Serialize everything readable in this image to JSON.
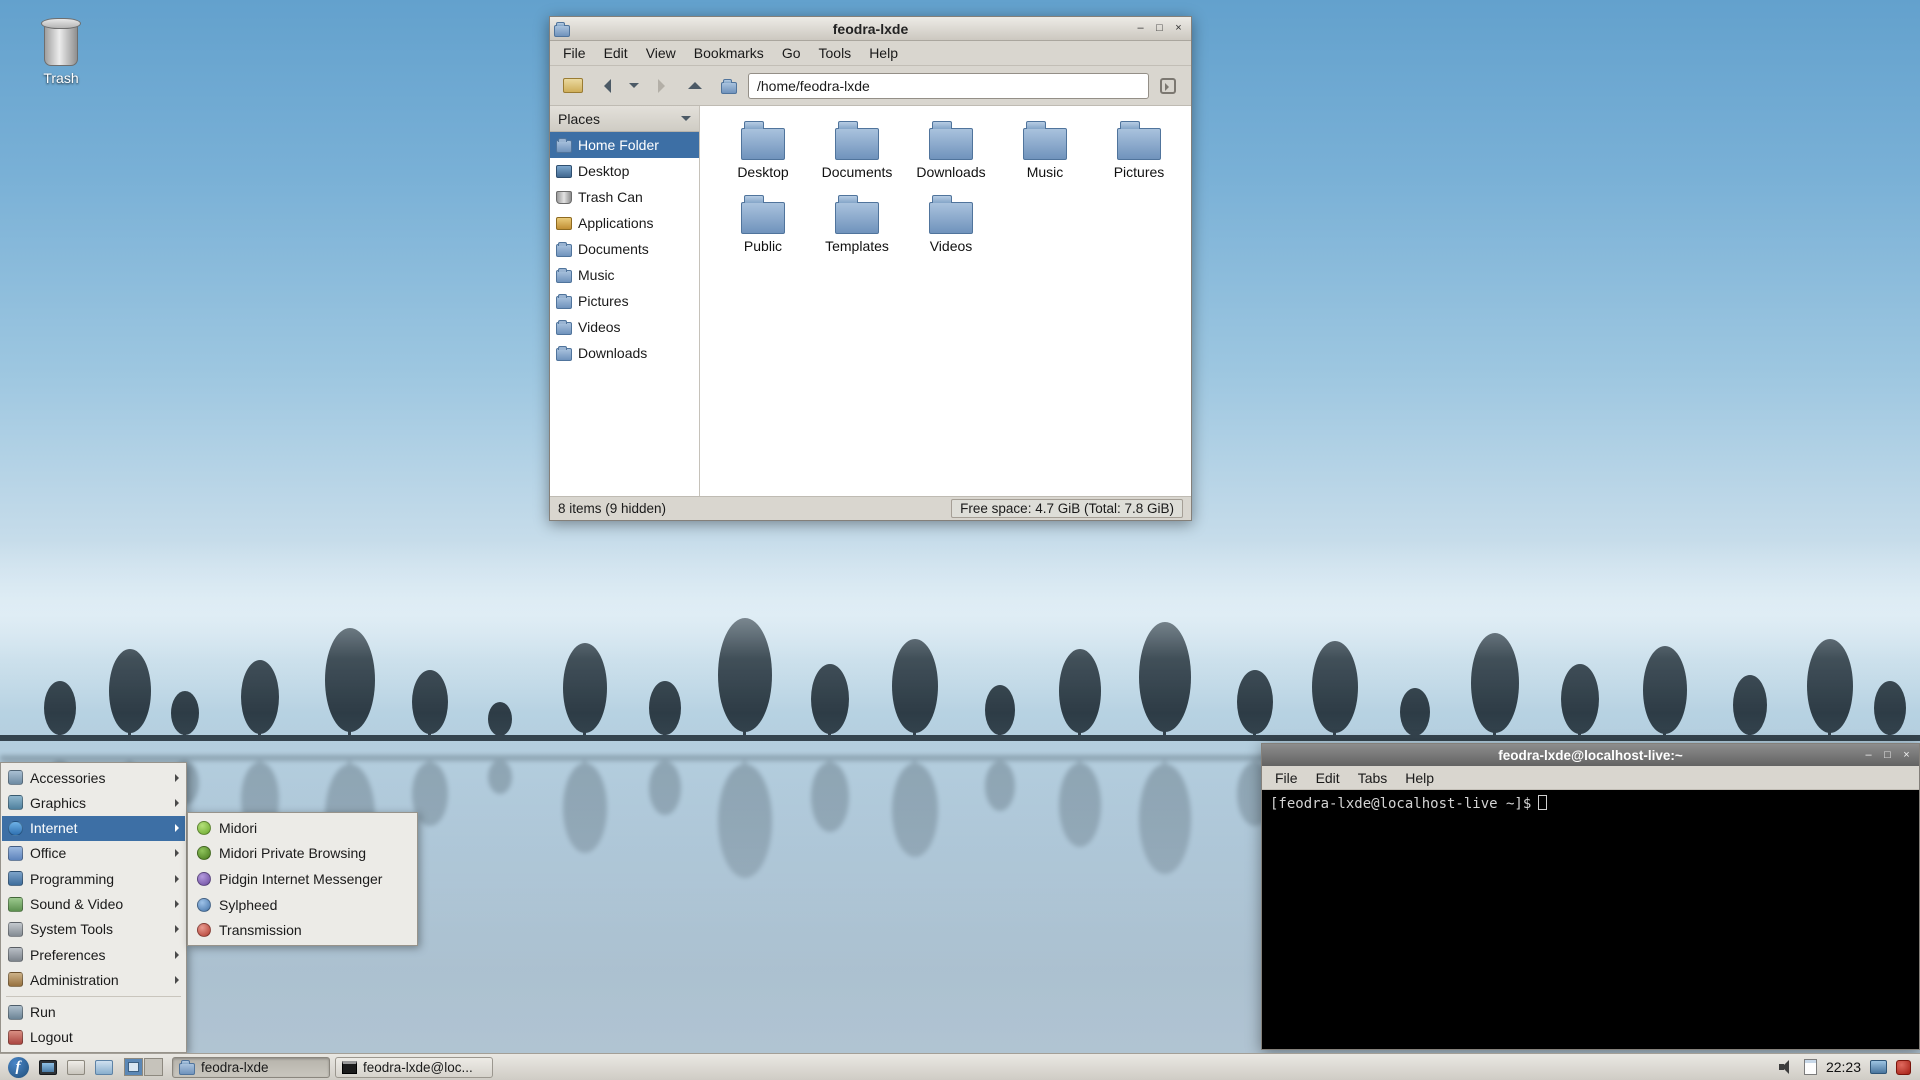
{
  "colors": {
    "selection_blue": "#3d6fa5",
    "folder_blue": "#7093bc",
    "terminal_bg": "#000000"
  },
  "window_controls": {
    "minimize": "–",
    "maximize": "□",
    "close": "×"
  },
  "desktop": {
    "trash_label": "Trash"
  },
  "file_manager": {
    "title": "feodra-lxde",
    "menu": [
      "File",
      "Edit",
      "View",
      "Bookmarks",
      "Go",
      "Tools",
      "Help"
    ],
    "path": "/home/feodra-lxde",
    "places_header": "Places",
    "places": [
      {
        "label": "Home Folder"
      },
      {
        "label": "Desktop"
      },
      {
        "label": "Trash Can"
      },
      {
        "label": "Applications"
      },
      {
        "label": "Documents"
      },
      {
        "label": "Music"
      },
      {
        "label": "Pictures"
      },
      {
        "label": "Videos"
      },
      {
        "label": "Downloads"
      }
    ],
    "files": [
      "Desktop",
      "Documents",
      "Downloads",
      "Music",
      "Pictures",
      "Public",
      "Templates",
      "Videos"
    ],
    "status_left": "8 items (9 hidden)",
    "status_right": "Free space: 4.7 GiB (Total: 7.8 GiB)"
  },
  "terminal": {
    "title": "feodra-lxde@localhost-live:~",
    "menu": [
      "File",
      "Edit",
      "Tabs",
      "Help"
    ],
    "prompt": "[feodra-lxde@localhost-live ~]$"
  },
  "start_menu": {
    "items": [
      {
        "label": "Accessories"
      },
      {
        "label": "Graphics"
      },
      {
        "label": "Internet"
      },
      {
        "label": "Office"
      },
      {
        "label": "Programming"
      },
      {
        "label": "Sound & Video"
      },
      {
        "label": "System Tools"
      },
      {
        "label": "Preferences"
      },
      {
        "label": "Administration"
      },
      {
        "label": "Run"
      },
      {
        "label": "Logout"
      }
    ],
    "internet_submenu": [
      "Midori",
      "Midori Private Browsing",
      "Pidgin Internet Messenger",
      "Sylpheed",
      "Transmission"
    ]
  },
  "taskbar": {
    "logo_letter": "f",
    "tasks": [
      {
        "label": "feodra-lxde"
      },
      {
        "label": "feodra-lxde@loc..."
      }
    ],
    "clock": "22:23"
  }
}
